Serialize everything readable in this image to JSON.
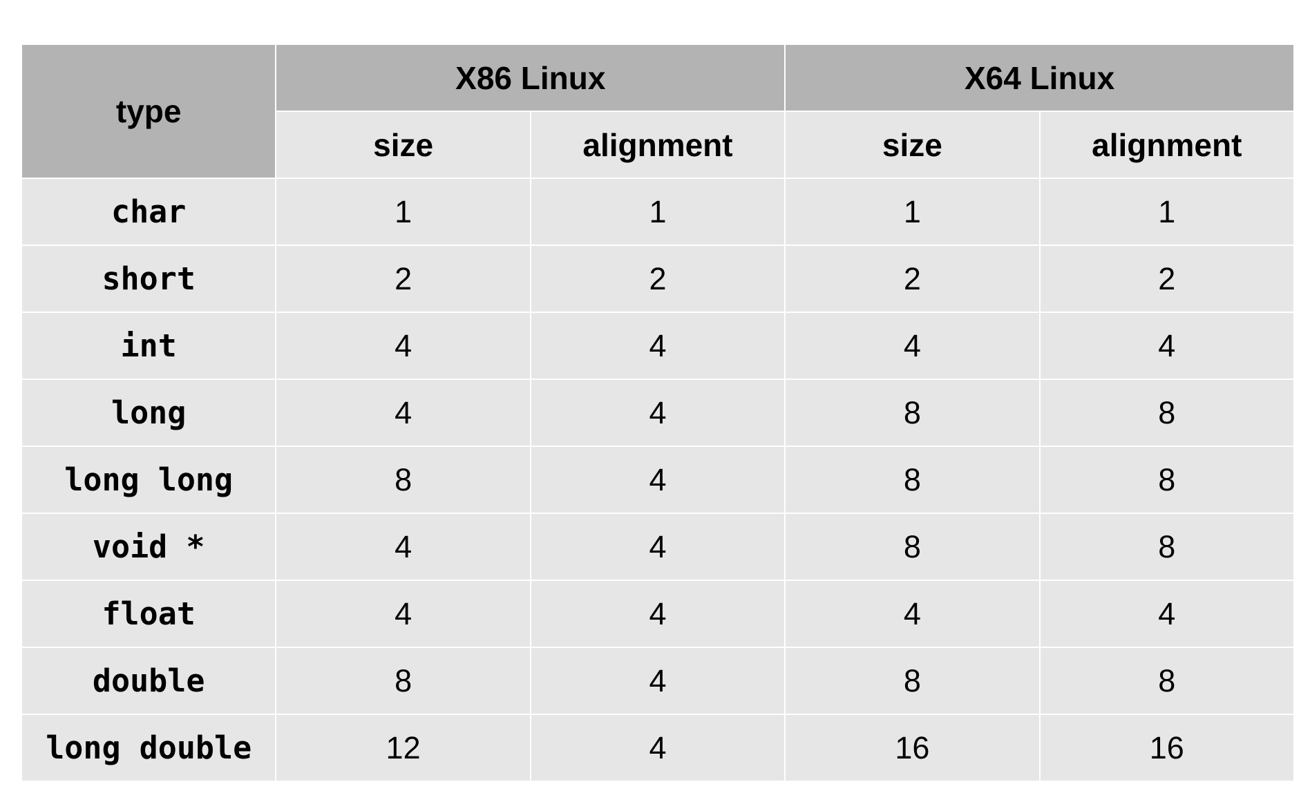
{
  "table": {
    "header": {
      "type_label": "type",
      "groups": [
        "X86 Linux",
        "X64 Linux"
      ],
      "subcolumns": [
        "size",
        "alignment",
        "size",
        "alignment"
      ]
    },
    "rows": [
      {
        "type": "char",
        "values": [
          "1",
          "1",
          "1",
          "1"
        ]
      },
      {
        "type": "short",
        "values": [
          "2",
          "2",
          "2",
          "2"
        ]
      },
      {
        "type": "int",
        "values": [
          "4",
          "4",
          "4",
          "4"
        ]
      },
      {
        "type": "long",
        "values": [
          "4",
          "4",
          "8",
          "8"
        ]
      },
      {
        "type": "long long",
        "values": [
          "8",
          "4",
          "8",
          "8"
        ]
      },
      {
        "type": "void *",
        "values": [
          "4",
          "4",
          "8",
          "8"
        ]
      },
      {
        "type": "float",
        "values": [
          "4",
          "4",
          "4",
          "4"
        ]
      },
      {
        "type": "double",
        "values": [
          "8",
          "4",
          "8",
          "8"
        ]
      },
      {
        "type": "long double",
        "values": [
          "12",
          "4",
          "16",
          "16"
        ]
      }
    ]
  },
  "colors": {
    "header_dark": "#b3b3b3",
    "cell_light": "#e6e6e6",
    "grid_line": "#ffffff"
  }
}
